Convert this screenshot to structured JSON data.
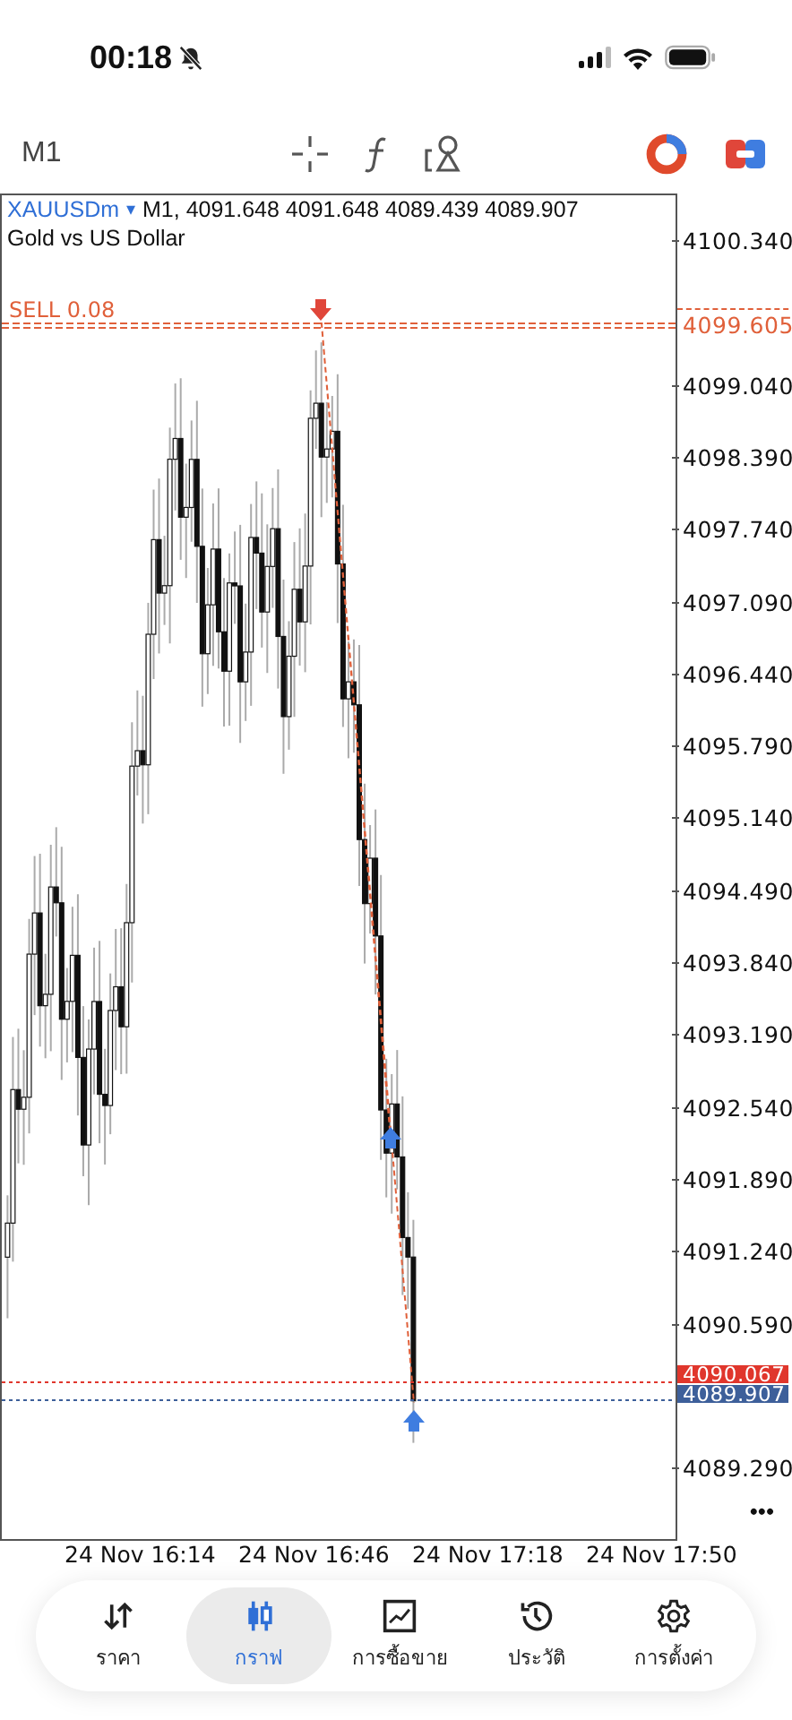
{
  "status_bar": {
    "time": "00:18"
  },
  "toolbar": {
    "timeframe": "M1"
  },
  "chart": {
    "symbol": "XAUUSDm",
    "symbol_caret": "▾",
    "ohlc": "M1, 4091.648 4091.648 4089.439 4089.907",
    "description": "Gold vs US Dollar",
    "order_label": "SELL 0.08",
    "price_ticks": [
      "4100.340",
      "4099.040",
      "4098.390",
      "4097.740",
      "4097.090",
      "4096.440",
      "4095.790",
      "4095.140",
      "4094.490",
      "4093.840",
      "4093.190",
      "4092.540",
      "4091.890",
      "4091.240",
      "4090.590",
      "4089.290"
    ],
    "price_tags": [
      {
        "value": "4099.605",
        "kind": "order"
      },
      {
        "value": "4090.067",
        "kind": "ask"
      },
      {
        "value": "4089.907",
        "kind": "bid"
      }
    ],
    "time_labels": [
      "24 Nov 16:14",
      "24 Nov 16:46",
      "24 Nov 17:18",
      "24 Nov 17:50"
    ],
    "more": "•••"
  },
  "nav": [
    {
      "label": "ราคา",
      "selected": false
    },
    {
      "label": "กราฟ",
      "selected": true
    },
    {
      "label": "การซื้อขาย",
      "selected": false
    },
    {
      "label": "ประวัติ",
      "selected": false
    },
    {
      "label": "การตั้งค่า",
      "selected": false
    }
  ]
}
